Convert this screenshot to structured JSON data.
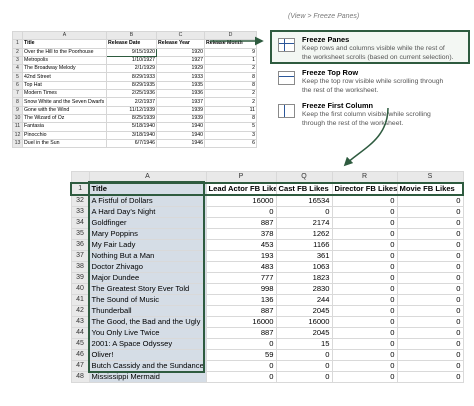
{
  "breadcrumb": "(View > Freeze Panes)",
  "menu": [
    {
      "title": "Freeze Panes",
      "desc_lines": [
        "Keep rows and columns visible while the rest of",
        "the worksheet scrolls (based on current selection)."
      ],
      "icon": "freeze-panes-icon"
    },
    {
      "title": "Freeze Top Row",
      "desc_lines": [
        "Keep the top row visible while scrolling through",
        "the rest of the worksheet."
      ],
      "icon": "freeze-top-row-icon"
    },
    {
      "title": "Freeze First Column",
      "desc_lines": [
        "Keep the first column visible while scrolling",
        "through the rest of the worksheet."
      ],
      "icon": "freeze-first-column-icon"
    }
  ],
  "small_sheet": {
    "columns": [
      "A",
      "B",
      "C",
      "D"
    ],
    "header": [
      "Title",
      "Release Date",
      "Release Year",
      "Release Month"
    ],
    "rows": [
      {
        "n": "2",
        "cells": [
          "Over the Hill to the Poorhouse",
          "9/15/1920",
          "1920",
          "9"
        ]
      },
      {
        "n": "3",
        "cells": [
          "Metropolis",
          "1/10/1927",
          "1927",
          "1"
        ]
      },
      {
        "n": "4",
        "cells": [
          "The Broadway Melody",
          "2/1/1929",
          "1929",
          "2"
        ]
      },
      {
        "n": "5",
        "cells": [
          "42nd Street",
          "8/29/1933",
          "1933",
          "8"
        ]
      },
      {
        "n": "6",
        "cells": [
          "Top Hat",
          "8/29/1935",
          "1935",
          "8"
        ]
      },
      {
        "n": "7",
        "cells": [
          "Modern Times",
          "2/25/1936",
          "1936",
          "2"
        ]
      },
      {
        "n": "8",
        "cells": [
          "Snow White and the Seven Dwarfs",
          "2/2/1937",
          "1937",
          "2"
        ]
      },
      {
        "n": "9",
        "cells": [
          "Gone with the Wind",
          "11/12/1939",
          "1939",
          "11"
        ]
      },
      {
        "n": "10",
        "cells": [
          "The Wizard of Oz",
          "8/25/1939",
          "1939",
          "8"
        ]
      },
      {
        "n": "11",
        "cells": [
          "Fantasia",
          "5/18/1940",
          "1940",
          "5"
        ]
      },
      {
        "n": "12",
        "cells": [
          "Pinocchio",
          "3/18/1940",
          "1940",
          "3"
        ]
      },
      {
        "n": "13",
        "cells": [
          "Duel in the Sun",
          "6/7/1946",
          "1946",
          "6"
        ]
      }
    ]
  },
  "big_sheet": {
    "columns": [
      "A",
      "P",
      "Q",
      "R",
      "S"
    ],
    "header_row_no": "1",
    "header": [
      "Title",
      "Lead Actor FB Likes",
      "Cast FB Likes",
      "Director FB Likes",
      "Movie FB Likes"
    ],
    "rows": [
      {
        "n": "32",
        "cells": [
          "A Fistful of Dollars",
          "16000",
          "16534",
          "0",
          "0"
        ]
      },
      {
        "n": "33",
        "cells": [
          "A Hard Day's Night",
          "0",
          "0",
          "0",
          "0"
        ]
      },
      {
        "n": "34",
        "cells": [
          "Goldfinger",
          "887",
          "2174",
          "0",
          "0"
        ]
      },
      {
        "n": "35",
        "cells": [
          "Mary Poppins",
          "378",
          "1262",
          "0",
          "0"
        ]
      },
      {
        "n": "36",
        "cells": [
          "My Fair Lady",
          "453",
          "1166",
          "0",
          "0"
        ]
      },
      {
        "n": "37",
        "cells": [
          "Nothing But a Man",
          "193",
          "361",
          "0",
          "0"
        ]
      },
      {
        "n": "38",
        "cells": [
          "Doctor Zhivago",
          "483",
          "1063",
          "0",
          "0"
        ]
      },
      {
        "n": "39",
        "cells": [
          "Major Dundee",
          "777",
          "1823",
          "0",
          "0"
        ]
      },
      {
        "n": "40",
        "cells": [
          "The Greatest Story Ever Told",
          "998",
          "2830",
          "0",
          "0"
        ]
      },
      {
        "n": "41",
        "cells": [
          "The Sound of Music",
          "136",
          "244",
          "0",
          "0"
        ]
      },
      {
        "n": "42",
        "cells": [
          "Thunderball",
          "887",
          "2045",
          "0",
          "0"
        ]
      },
      {
        "n": "43",
        "cells": [
          "The Good, the Bad and the Ugly",
          "16000",
          "16000",
          "0",
          "0"
        ]
      },
      {
        "n": "44",
        "cells": [
          "You Only Live Twice",
          "887",
          "2045",
          "0",
          "0"
        ]
      },
      {
        "n": "45",
        "cells": [
          "2001: A Space Odyssey",
          "0",
          "15",
          "0",
          "0"
        ]
      },
      {
        "n": "46",
        "cells": [
          "Oliver!",
          "59",
          "0",
          "0",
          "0"
        ]
      },
      {
        "n": "47",
        "cells": [
          "Butch Cassidy and the Sundance Kid",
          "0",
          "0",
          "0",
          "0"
        ]
      },
      {
        "n": "48",
        "cells": [
          "Mississippi Mermaid",
          "0",
          "0",
          "0",
          "0"
        ]
      }
    ]
  },
  "colors": {
    "highlight_border": "#2e5b3f",
    "frozen_column_fill": "#d5dde6",
    "header_fill": "#e9e9e9"
  }
}
